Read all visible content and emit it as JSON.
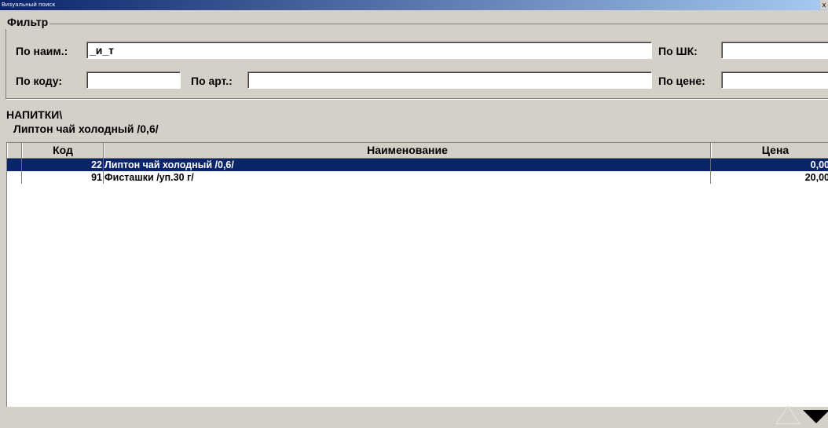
{
  "window": {
    "title": "Визуальный поиск",
    "close_glyph": "x"
  },
  "filter": {
    "legend": "Фильтр",
    "name_label": "По наим.:",
    "name_value": "_и_т",
    "barcode_label": "По ШК:",
    "barcode_value": "",
    "code_label": "По коду:",
    "code_value": "",
    "article_label": "По арт.:",
    "article_value": "",
    "price_label": "По цене:",
    "price_value": ""
  },
  "path": {
    "group": "НАПИТКИ\\",
    "item": "Липтон чай холодный /0,6/"
  },
  "table": {
    "columns": [
      "Код",
      "Наименование",
      "Цена"
    ],
    "rows": [
      {
        "code": "22",
        "name": "Липтон чай холодный /0,6/",
        "price": "0,00",
        "selected": true
      },
      {
        "code": "91",
        "name": "Фисташки /уп.30 г/",
        "price": "20,00",
        "selected": false
      }
    ]
  },
  "nav": {
    "up_icon": "triangle-up-icon",
    "down_icon": "triangle-down-icon"
  }
}
